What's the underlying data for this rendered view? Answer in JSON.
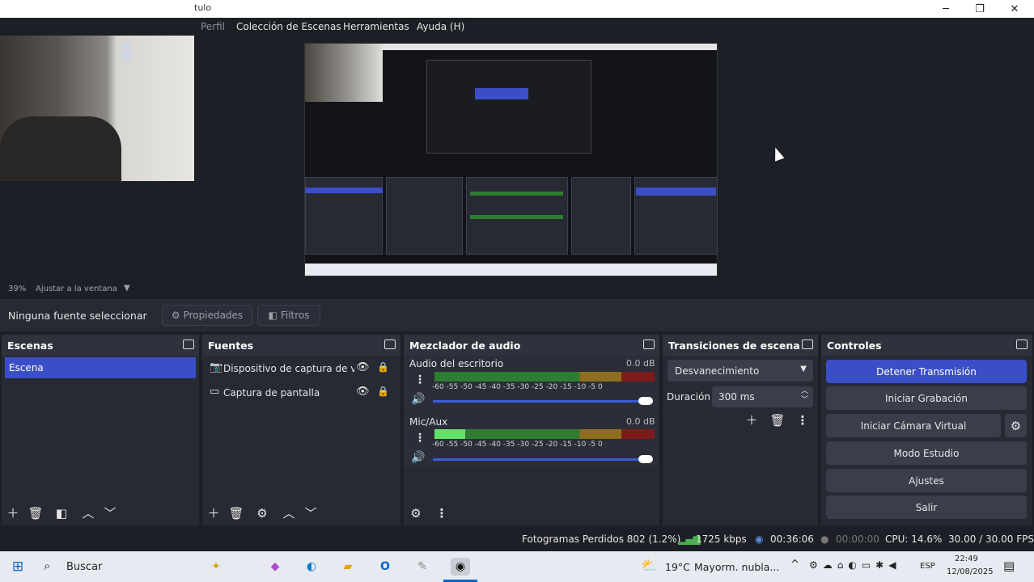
{
  "window": {
    "title": "tulo",
    "minimize": "─",
    "maximize": "❐",
    "close": "✕"
  },
  "menu": {
    "items": [
      "Perfil",
      "Colección de Escenas",
      "Herramientas",
      "Ayuda (H)"
    ]
  },
  "preview": {
    "zoom": "39%",
    "zoom_mode": "Ajustar a la ventana"
  },
  "source_toolbar": {
    "no_source": "Ninguna fuente seleccionar",
    "properties": "Propiedades",
    "filters": "Filtros"
  },
  "scenes": {
    "title": "Escenas",
    "items": [
      "Escena"
    ]
  },
  "sources": {
    "title": "Fuentes",
    "items": [
      "Dispositivo de captura de vídeo",
      "Captura de pantalla"
    ]
  },
  "mixer": {
    "title": "Mezclador de audio",
    "channels": [
      {
        "name": "Audio del escritorio",
        "db": "0.0 dB",
        "level": 0,
        "volume": 1.0
      },
      {
        "name": "Mic/Aux",
        "db": "0.0 dB",
        "level": 0.14,
        "volume": 1.0
      }
    ],
    "ticks": "-60 -55 -50 -45 -40 -35 -30 -25 -20 -15 -10 -5 0"
  },
  "transitions": {
    "title": "Transiciones de escena",
    "selected": "Desvanecimiento",
    "duration_label": "Duración",
    "duration": "300 ms"
  },
  "controls": {
    "title": "Controles",
    "stop_stream": "Detener Transmisión",
    "start_recording": "Iniciar Grabación",
    "start_virtual_cam": "Iniciar Cámara Virtual",
    "studio_mode": "Modo Estudio",
    "settings": "Ajustes",
    "exit": "Salir"
  },
  "status": {
    "dropped": "Fotogramas Perdidos 802 (1.2%)",
    "bitrate": "1725 kbps",
    "stream_time": "00:36:06",
    "rec_time": "00:00:00",
    "cpu": "CPU: 14.6%",
    "fps": "30.00 / 30.00 FPS"
  },
  "taskbar": {
    "search": "Buscar",
    "weather_temp": "19°C",
    "weather_desc": "Mayorm. nubla...",
    "lang": "ESP",
    "time": "22:49",
    "date": "12/08/2025"
  },
  "colors": {
    "accent": "#3a4fc7",
    "panel": "#272a33",
    "bg": "#1d1f26"
  }
}
